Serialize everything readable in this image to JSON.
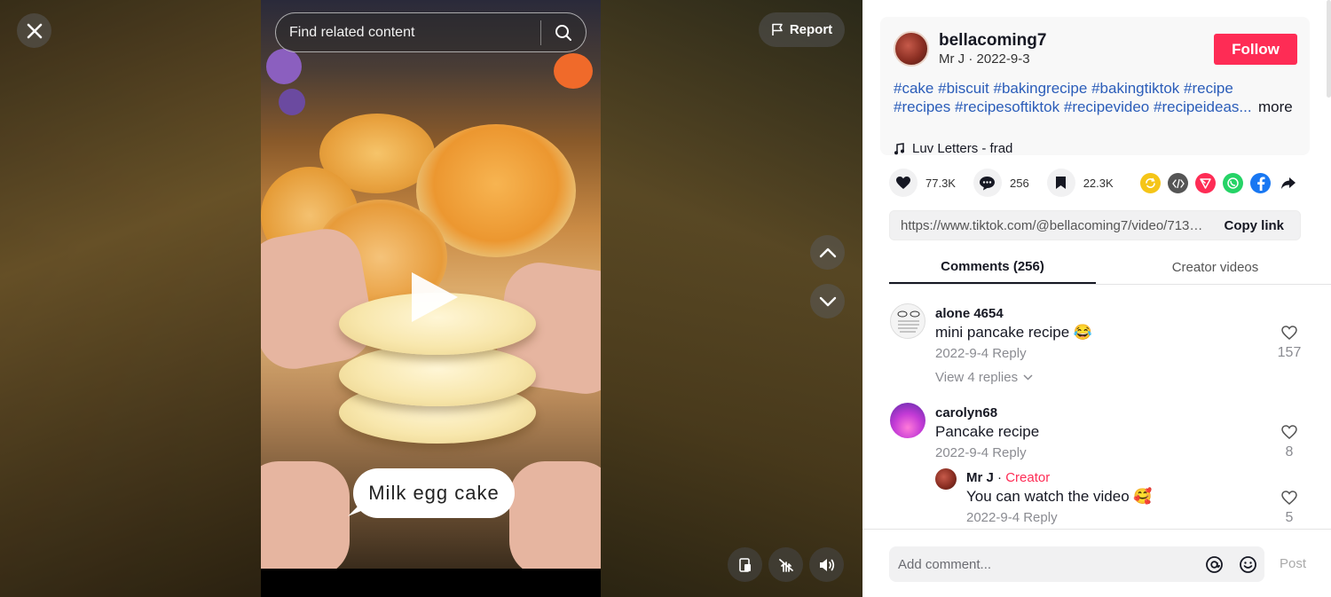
{
  "video": {
    "search_placeholder": "Find related content",
    "report_label": "Report",
    "caption": "Milk egg cake"
  },
  "author": {
    "username": "bellacoming7",
    "display_name": "Mr J",
    "date": "2022-9-3",
    "follow_label": "Follow"
  },
  "description": {
    "tags_line1": [
      "#cake",
      "#biscuit",
      "#bakingrecipe",
      "#bakingtiktok",
      "#recipe"
    ],
    "tags_line2": [
      "#recipes",
      "#recipesoftiktok",
      "#recipevideo",
      "#recipeideas..."
    ],
    "more_label": "more"
  },
  "music": {
    "title": "Luv Letters - frad"
  },
  "stats": {
    "likes": "77.3K",
    "comments": "256",
    "saves": "22.3K"
  },
  "share_colors": {
    "repost": "#f5c518",
    "embed": "#555555",
    "send": "#fe2c55",
    "whatsapp": "#25d366",
    "facebook": "#1877f2"
  },
  "link": {
    "url": "https://www.tiktok.com/@bellacoming7/video/713904...",
    "copy_label": "Copy link"
  },
  "tabs": {
    "comments": "Comments (256)",
    "creator_videos": "Creator videos"
  },
  "comments": [
    {
      "user": "alone 4654",
      "text": "mini pancake recipe 😂",
      "date": "2022-9-4",
      "reply": "Reply",
      "likes": "157",
      "view_replies": "View 4 replies"
    },
    {
      "user": "carolyn68",
      "text": "Pancake recipe",
      "date": "2022-9-4",
      "reply": "Reply",
      "likes": "8",
      "sub": {
        "user": "Mr J",
        "badge": "Creator",
        "text": "You can watch the video 🥰",
        "date": "2022-9-4",
        "reply": "Reply",
        "likes": "5"
      }
    }
  ],
  "composer": {
    "placeholder": "Add comment...",
    "post_label": "Post"
  },
  "colors": {
    "accent": "#fe2c55",
    "hashtag": "#2b5db9"
  }
}
